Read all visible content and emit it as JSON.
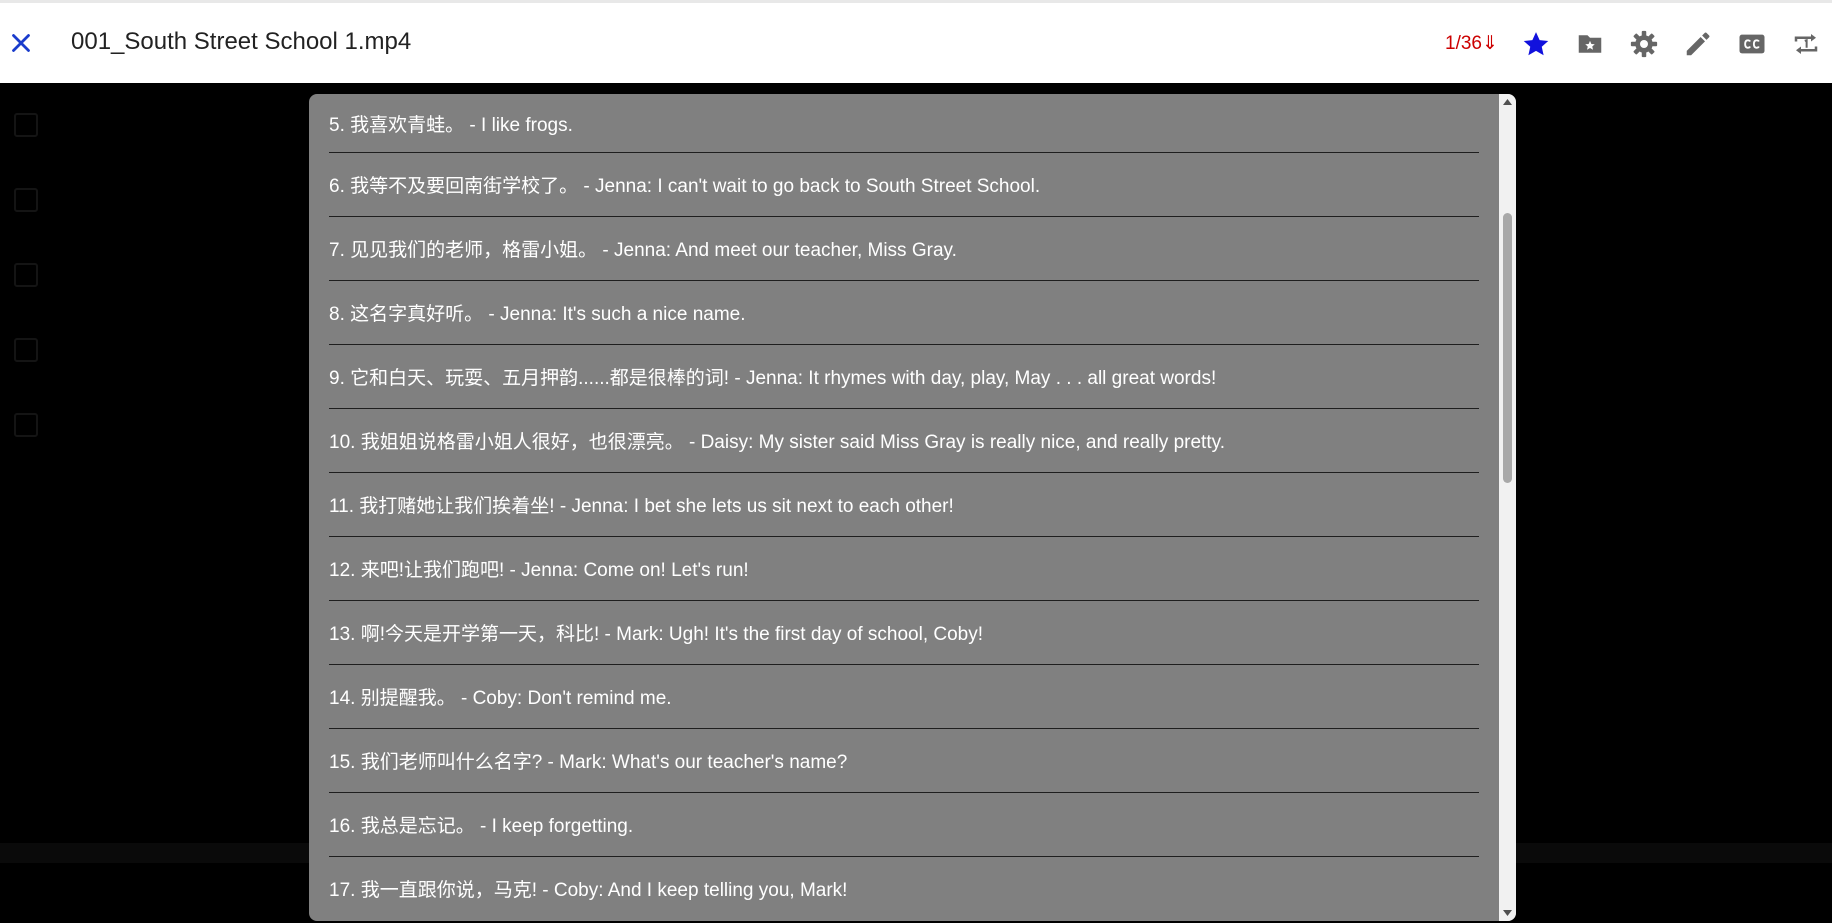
{
  "window": {
    "title": "001_South Street School 1.mp4",
    "counter": "1/36⇓"
  },
  "toolbar": {
    "icons": [
      "close-icon",
      "star-icon",
      "folder-star-icon",
      "gear-icon",
      "pencil-icon",
      "closed-captions-icon",
      "repeat-icon"
    ],
    "star_color": "#1111dd",
    "icon_color": "#666666",
    "close_color": "#1a3ccc",
    "counter_color": "#cc0000"
  },
  "subtitles": [
    "5. 我喜欢青蛙。 - I like frogs.",
    "6. 我等不及要回南街学校了。 - Jenna: I can't wait to go back to South Street School.",
    "7. 见见我们的老师，格雷小姐。 - Jenna: And meet our teacher, Miss Gray.",
    "8. 这名字真好听。 - Jenna: It's such a nice name.",
    "9. 它和白天、玩耍、五月押韵......都是很棒的词! - Jenna: It rhymes with day, play, May . . . all great words!",
    "10. 我姐姐说格雷小姐人很好，也很漂亮。 - Daisy: My sister said Miss Gray is really nice, and really pretty.",
    "11. 我打赌她让我们挨着坐! - Jenna: I bet she lets us sit next to each other!",
    "12. 来吧!让我们跑吧! - Jenna: Come on! Let's run!",
    "13. 啊!今天是开学第一天，科比! - Mark: Ugh! It's the first day of school, Coby!",
    "14. 别提醒我。 - Coby: Don't remind me.",
    "15. 我们老师叫什么名字? - Mark: What's our teacher's name?",
    "16. 我总是忘记。 - I keep forgetting.",
    "17. 我一直跟你说，马克! - Coby: And I keep telling you, Mark!"
  ],
  "panel_color": "#808080"
}
